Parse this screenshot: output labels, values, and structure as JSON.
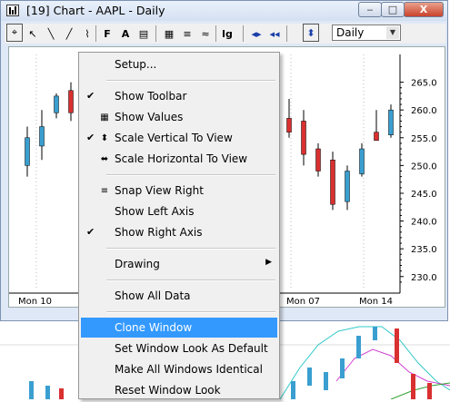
{
  "window": {
    "title": "[19]  Chart - AAPL - Daily",
    "min_label": "‒",
    "max_label": "□",
    "close_label": "X"
  },
  "toolbar": {
    "tools": [
      {
        "icon": "crosshair-icon",
        "glyph": "⌖"
      },
      {
        "icon": "pointer-icon",
        "glyph": "↖"
      },
      {
        "icon": "line-tool-icon",
        "glyph": "╲"
      },
      {
        "icon": "trend-tool-icon",
        "glyph": "╱"
      },
      {
        "icon": "channel-tool-icon",
        "glyph": "⌇"
      },
      {
        "icon": "fibonacci-icon",
        "glyph": "F"
      },
      {
        "icon": "text-tool-icon",
        "glyph": "A"
      },
      {
        "icon": "note-icon",
        "glyph": "▤"
      },
      {
        "icon": "values-table-icon",
        "glyph": "▦"
      },
      {
        "icon": "snap-icon",
        "glyph": "≡"
      },
      {
        "icon": "chart-type-icon",
        "glyph": "≈"
      },
      {
        "icon": "log-scale-icon",
        "glyph": "lg"
      },
      {
        "icon": "scroll-left-right-icon",
        "glyph": "◂▸"
      },
      {
        "icon": "scroll-end-icon",
        "glyph": "◂◂"
      },
      {
        "icon": "scale-vertical-icon",
        "glyph": "⬍"
      }
    ],
    "interval_value": "Daily"
  },
  "chart_data": {
    "type": "candlestick",
    "x_labels": [
      "Mon 10",
      "Mon 07",
      "Mon 14"
    ],
    "y_ticks": [
      230.0,
      235.0,
      240.0,
      245.0,
      250.0,
      255.0,
      260.0,
      265.0
    ],
    "ylim": [
      228.0,
      270.0
    ],
    "candles_left": [
      {
        "open": 250.0,
        "high": 257.0,
        "low": 248.0,
        "close": 255.0,
        "dir": "up"
      },
      {
        "open": 253.5,
        "high": 260.0,
        "low": 251.0,
        "close": 257.0,
        "dir": "up"
      },
      {
        "open": 259.5,
        "high": 263.0,
        "low": 258.5,
        "close": 262.5,
        "dir": "up"
      },
      {
        "open": 263.5,
        "high": 265.0,
        "low": 258.0,
        "close": 259.5,
        "dir": "down"
      }
    ],
    "candles_right": [
      {
        "open": 258.5,
        "high": 262.0,
        "low": 255.0,
        "close": 256.0,
        "dir": "down"
      },
      {
        "open": 258.0,
        "high": 260.0,
        "low": 250.0,
        "close": 252.0,
        "dir": "down"
      },
      {
        "open": 253.0,
        "high": 254.0,
        "low": 248.0,
        "close": 249.0,
        "dir": "down"
      },
      {
        "open": 251.0,
        "high": 252.5,
        "low": 242.0,
        "close": 243.0,
        "dir": "down"
      },
      {
        "open": 243.5,
        "high": 250.0,
        "low": 242.0,
        "close": 249.0,
        "dir": "up"
      },
      {
        "open": 248.5,
        "high": 254.0,
        "low": 248.0,
        "close": 253.0,
        "dir": "up"
      },
      {
        "open": 256.0,
        "high": 260.0,
        "low": 255.0,
        "close": 254.5,
        "dir": "down"
      },
      {
        "open": 255.5,
        "high": 261.0,
        "low": 255.0,
        "close": 260.0,
        "dir": "up"
      }
    ],
    "colors": {
      "up": "#3a9fd0",
      "down": "#d93030"
    }
  },
  "context_menu": {
    "items": [
      {
        "label": "Setup...",
        "check": false,
        "icon": ""
      },
      {
        "sep": true
      },
      {
        "label": "Show Toolbar",
        "check": true,
        "icon": ""
      },
      {
        "label": "Show Values",
        "check": false,
        "icon": "values-icon",
        "glyph": "▦"
      },
      {
        "label": "Scale Vertical To View",
        "check": true,
        "icon": "scale-vertical-icon",
        "glyph": "⬍"
      },
      {
        "label": "Scale Horizontal To View",
        "check": false,
        "icon": "scale-horizontal-icon",
        "glyph": "⬌"
      },
      {
        "sep": true
      },
      {
        "label": "Snap View Right",
        "check": false,
        "icon": "snap-right-icon",
        "glyph": "≡"
      },
      {
        "label": "Show Left Axis",
        "check": false,
        "icon": ""
      },
      {
        "label": "Show Right Axis",
        "check": true,
        "icon": ""
      },
      {
        "sep": true
      },
      {
        "label": "Drawing",
        "check": false,
        "icon": "",
        "submenu": true
      },
      {
        "sep": true
      },
      {
        "label": "Show All Data",
        "check": false,
        "icon": ""
      },
      {
        "sep": true
      },
      {
        "label": "Clone Window",
        "check": false,
        "icon": "",
        "highlight": true
      },
      {
        "label": "Set Window Look As Default",
        "check": false,
        "icon": ""
      },
      {
        "label": "Make All Windows Identical",
        "check": false,
        "icon": ""
      },
      {
        "label": "Reset Window Look",
        "check": false,
        "icon": ""
      }
    ]
  }
}
